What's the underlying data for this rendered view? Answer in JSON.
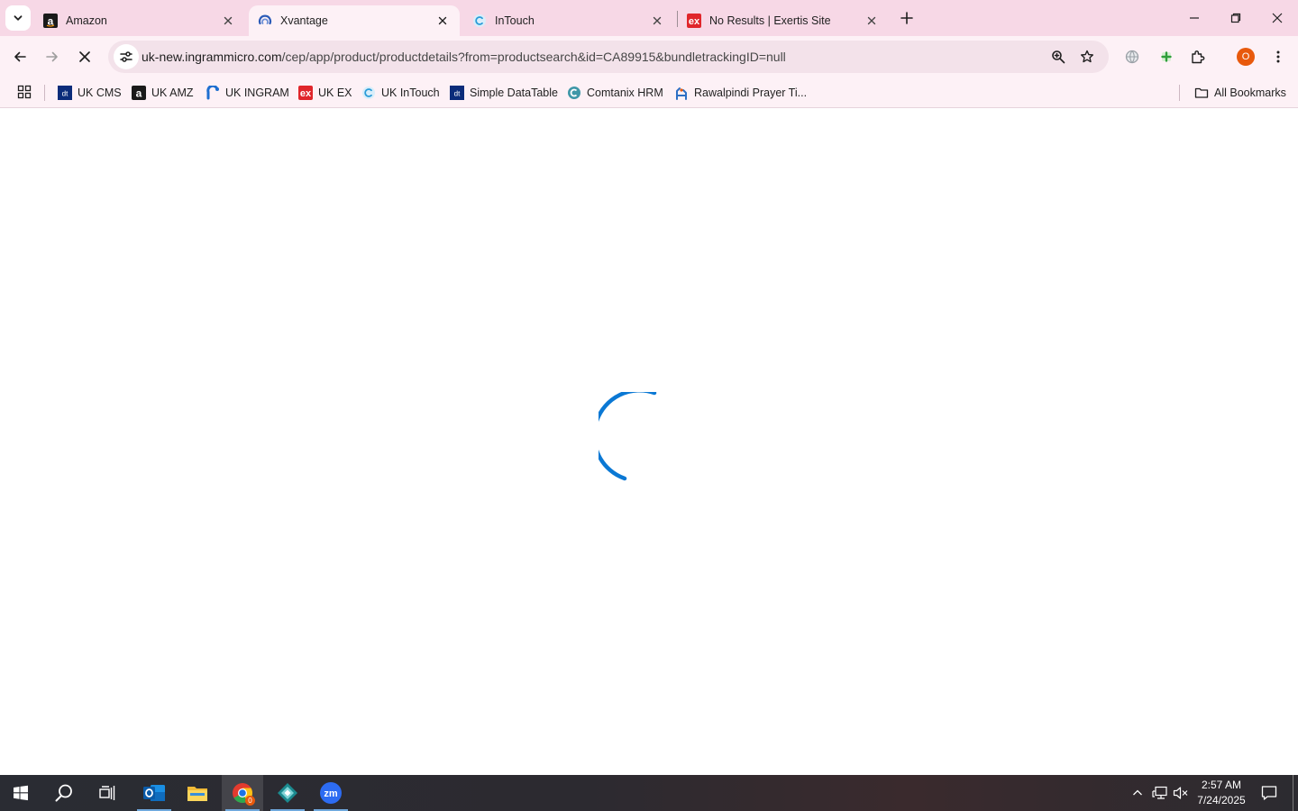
{
  "browser": {
    "tabs": [
      {
        "title": "Amazon",
        "favicon": "amazon-a-icon",
        "active": false
      },
      {
        "title": "Xvantage",
        "favicon": "xvantage-icon",
        "active": true
      },
      {
        "title": "InTouch",
        "favicon": "intouch-icon",
        "active": false
      },
      {
        "title": "No Results | Exertis Site",
        "favicon": "exertis-icon",
        "active": false
      }
    ],
    "address": {
      "host": "uk-new.ingrammicro.com",
      "path": "/cep/app/product/productdetails?from=productsearch&id=CA89915&bundletrackingID=null"
    },
    "profile_initial": "O",
    "bookmarks": [
      {
        "label": "UK CMS",
        "icon": "dt-icon"
      },
      {
        "label": "UK AMZ",
        "icon": "amazon-a-icon"
      },
      {
        "label": "UK INGRAM",
        "icon": "ingram-icon"
      },
      {
        "label": "UK EX",
        "icon": "exertis-icon"
      },
      {
        "label": "UK InTouch",
        "icon": "intouch-icon"
      },
      {
        "label": "Simple DataTable",
        "icon": "dt-icon"
      },
      {
        "label": "Comtanix HRM",
        "icon": "comtanix-icon"
      },
      {
        "label": "Rawalpindi Prayer Ti...",
        "icon": "prayer-icon"
      }
    ],
    "all_bookmarks_label": "All Bookmarks"
  },
  "page": {
    "state": "loading",
    "spinner_color": "#0a78d4"
  },
  "taskbar": {
    "apps": [
      "windows-start-icon",
      "search-icon",
      "task-view-icon",
      "outlook-icon",
      "file-explorer-icon",
      "chrome-icon",
      "app-diamond-icon",
      "zoom-icon"
    ],
    "chrome_badge": "0",
    "time": "2:57 AM",
    "date": "7/24/2025"
  },
  "colors": {
    "tabstrip": "#f7d8e6",
    "toolbar": "#fdf1f6",
    "accent": "#0a78d4",
    "profile": "#e8590c"
  }
}
